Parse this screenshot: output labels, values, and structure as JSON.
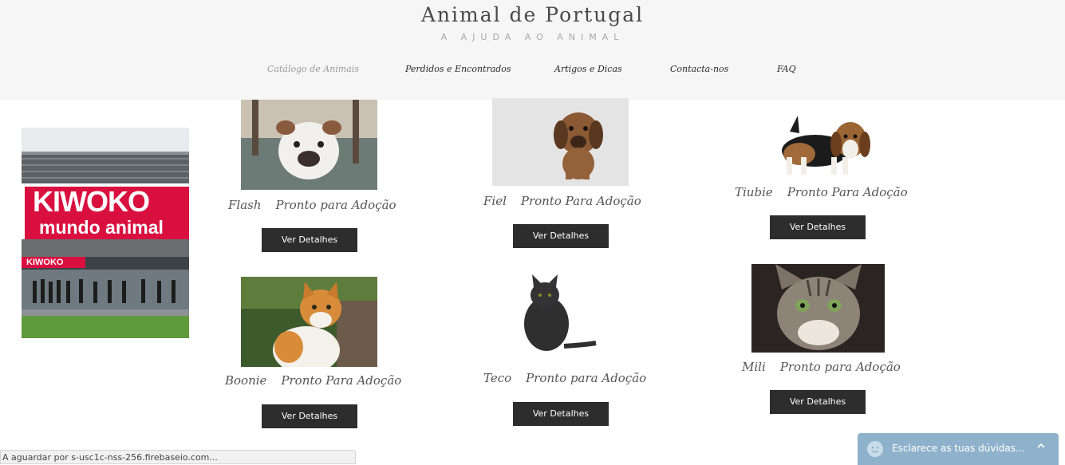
{
  "header": {
    "title": "Animal de Portugal",
    "tagline": "A AJUDA AO ANIMAL"
  },
  "nav": {
    "items": [
      {
        "label": "Catálogo de Animais",
        "active": true
      },
      {
        "label": "Perdidos e Encontrados",
        "active": false
      },
      {
        "label": "Artigos e Dicas",
        "active": false
      },
      {
        "label": "Contacta-nos",
        "active": false
      },
      {
        "label": "FAQ",
        "active": false
      }
    ]
  },
  "ad": {
    "brand": "KIWOKO",
    "slogan": "mundo animal",
    "brand_small": "KIWOKO"
  },
  "pets": [
    {
      "name": "Flash",
      "status": "Pronto para Adoção",
      "button": "Ver Detalhes",
      "icon": "dog-photo"
    },
    {
      "name": "Fiel",
      "status": "Pronto Para Adoção",
      "button": "Ver Detalhes",
      "icon": "puppy-photo"
    },
    {
      "name": "Tiubie",
      "status": "Pronto Para Adoção",
      "button": "Ver Detalhes",
      "icon": "beagle-photo"
    },
    {
      "name": "Boonie",
      "status": "Pronto Para Adoção",
      "button": "Ver Detalhes",
      "icon": "cat-photo"
    },
    {
      "name": "Teco",
      "status": "Pronto para Adoção",
      "button": "Ver Detalhes",
      "icon": "kitten-photo"
    },
    {
      "name": "Mili",
      "status": "Pronto para Adoção",
      "button": "Ver Detalhes",
      "icon": "tabby-cat-photo"
    }
  ],
  "statusbar": {
    "text": "A aguardar por s-usc1c-nss-256.firebaseio.com..."
  },
  "chat": {
    "label": "Esclarece as tuas dúvidas...",
    "chevron": "^"
  },
  "colors": {
    "header_bg": "#f6f6f6",
    "button_bg": "#2d2d2d",
    "chat_bg": "#8fb2cc",
    "ad_red": "#d9103f"
  }
}
